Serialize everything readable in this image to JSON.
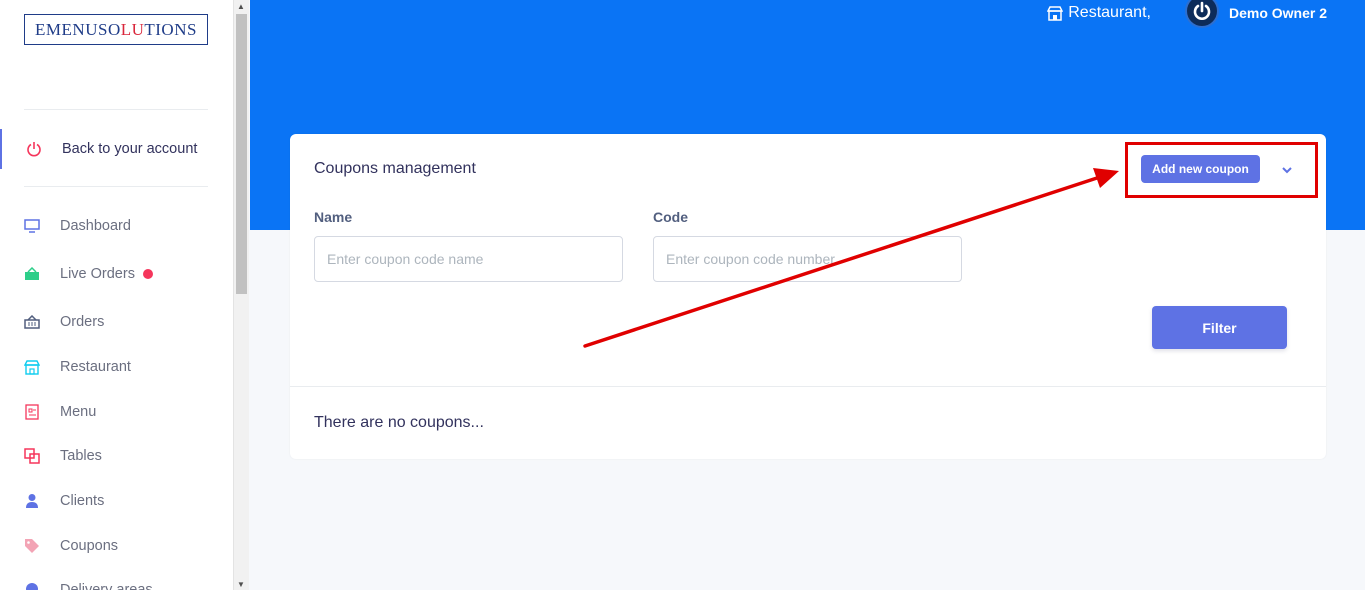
{
  "brand": {
    "logo_text_before": "EMENUSO",
    "logo_text_highlight": "LU",
    "logo_text_after": "TIONS"
  },
  "sidebar": {
    "back_label": "Back to your account",
    "items": [
      {
        "label": "Dashboard",
        "icon": "monitor-icon",
        "color": "#5e72e4"
      },
      {
        "label": "Live Orders",
        "icon": "basket-icon",
        "color": "#2dce89"
      },
      {
        "label": "Orders",
        "icon": "basket-icon",
        "color": "#525f7f"
      },
      {
        "label": "Restaurant",
        "icon": "shop-icon",
        "color": "#11cdef"
      },
      {
        "label": "Menu",
        "icon": "menu-book-icon",
        "color": "#f5365c"
      },
      {
        "label": "Tables",
        "icon": "tables-icon",
        "color": "#f5365c"
      },
      {
        "label": "Clients",
        "icon": "user-icon",
        "color": "#5e72e4"
      },
      {
        "label": "Coupons",
        "icon": "tag-icon",
        "color": "#f3a4b5"
      },
      {
        "label": "Delivery areas",
        "icon": "pin-icon",
        "color": "#5e72e4"
      }
    ]
  },
  "header": {
    "restaurant_label": "Restaurant,",
    "user_name": "Demo Owner 2",
    "bg_color": "#0a74f5"
  },
  "card": {
    "title": "Coupons management",
    "add_button": "Add new coupon",
    "name_label": "Name",
    "name_placeholder": "Enter coupon code name",
    "code_label": "Code",
    "code_placeholder": "Enter coupon code number",
    "filter_button": "Filter",
    "empty_message": "There are no coupons..."
  },
  "annotation": {
    "color": "#e00000"
  }
}
